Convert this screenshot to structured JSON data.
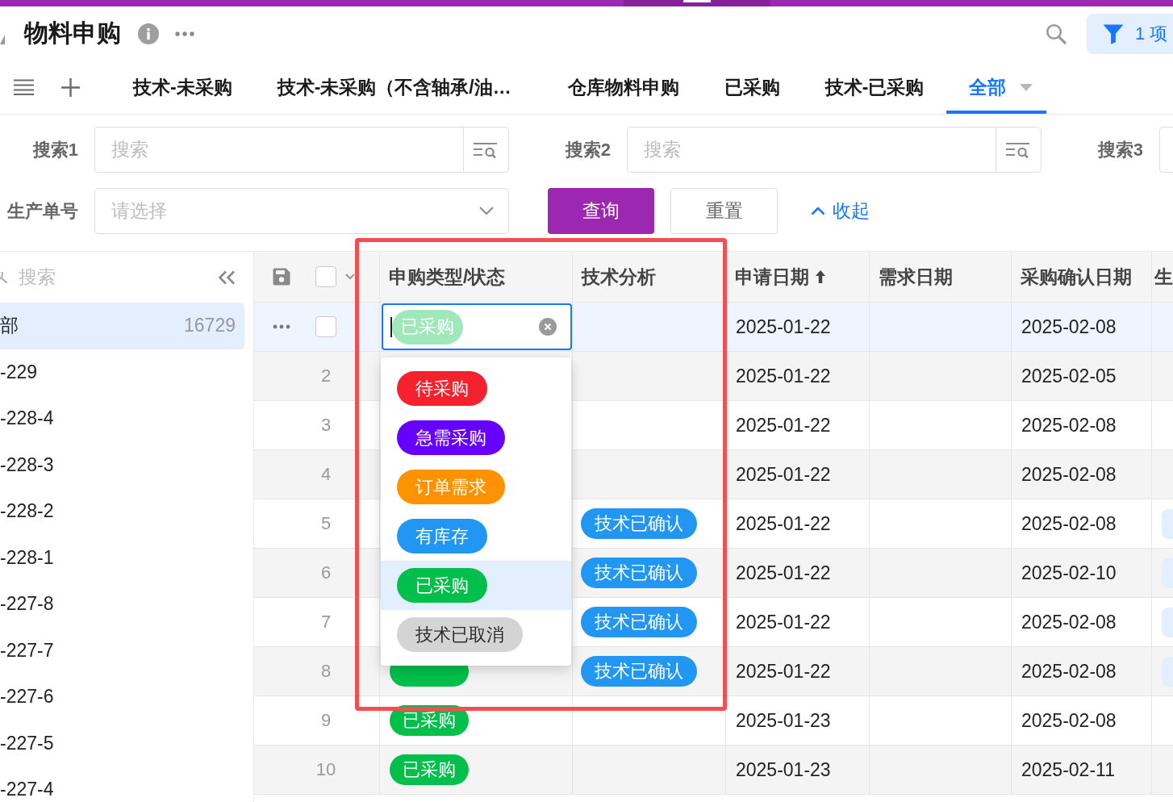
{
  "header": {
    "title": "物料申购",
    "filter_count": "1 项"
  },
  "view_tabs": [
    {
      "label": "技术-未采购",
      "selected": false
    },
    {
      "label": "技术-未采购（不含轴承/油…",
      "selected": false
    },
    {
      "label": "仓库物料申购",
      "selected": false
    },
    {
      "label": "已采购",
      "selected": false
    },
    {
      "label": "技术-已采购",
      "selected": false
    },
    {
      "label": "全部",
      "selected": true
    }
  ],
  "filters": {
    "search_fields": [
      {
        "label": "搜索1",
        "placeholder": "搜索"
      },
      {
        "label": "搜索2",
        "placeholder": "搜索"
      },
      {
        "label": "搜索3"
      }
    ],
    "production_number": {
      "label": "生产单号",
      "placeholder": "请选择"
    },
    "buttons": [
      {
        "label": "查询",
        "kind": "primary"
      },
      {
        "label": "重置",
        "kind": "default"
      }
    ],
    "collapse_link": "收起"
  },
  "sidebar": {
    "search": {
      "placeholder": "搜索"
    },
    "items": [
      {
        "label": "部",
        "count": "16729",
        "selected": true
      },
      {
        "label": "-229",
        "selected": false
      },
      {
        "label": "-228-4",
        "selected": false
      },
      {
        "label": "-228-3",
        "selected": false
      },
      {
        "label": "-228-2",
        "selected": false
      },
      {
        "label": "-228-1",
        "selected": false
      },
      {
        "label": "-227-8",
        "selected": false
      },
      {
        "label": "-227-7",
        "selected": false
      },
      {
        "label": "-227-6",
        "selected": false
      },
      {
        "label": "-227-5",
        "selected": false
      },
      {
        "label": "-227-4",
        "selected": false
      }
    ]
  },
  "table": {
    "select_all_checked": false,
    "columns": [
      {
        "label": "申购类型/状态"
      },
      {
        "label": "技术分析"
      },
      {
        "label": "申请日期",
        "sorted": true
      },
      {
        "label": "需求日期"
      },
      {
        "label": "采购确认日期"
      },
      {
        "label": "生"
      }
    ],
    "rows": [
      {
        "selected": true,
        "checked": false,
        "type_editor": {
          "value": {
            "label": "已采购",
            "color": "#a0e8bb"
          },
          "options": [
            {
              "label": "待采购",
              "color": "#f5222d",
              "selected": false
            },
            {
              "label": "急需采购",
              "color": "#6600ff",
              "selected": false
            },
            {
              "label": "订单需求",
              "color": "#ff9200",
              "selected": false
            },
            {
              "label": "有库存",
              "color": "#2196f3",
              "selected": false
            },
            {
              "label": "已采购",
              "color": "#00c04b",
              "selected": true
            },
            {
              "label": "技术已取消",
              "color": "#d4d4d4",
              "selected": false
            }
          ]
        },
        "apply_date": "2025-01-22",
        "confirm_date": "2025-02-08",
        "column_7_tag": false
      },
      {
        "number": "2",
        "selected": false,
        "apply_date": "2025-01-22",
        "confirm_date": "2025-02-05",
        "column_7_tag": false
      },
      {
        "number": "3",
        "selected": false,
        "apply_date": "2025-01-22",
        "confirm_date": "2025-02-08",
        "column_7_tag": false
      },
      {
        "number": "4",
        "selected": false,
        "apply_date": "2025-01-22",
        "confirm_date": "2025-02-08",
        "column_7_tag": false
      },
      {
        "number": "5",
        "selected": false,
        "analysis_tag": {
          "label": "技术已确认",
          "color": "#2196f3"
        },
        "apply_date": "2025-01-22",
        "confirm_date": "2025-02-08",
        "column_7_tag": true
      },
      {
        "number": "6",
        "selected": false,
        "analysis_tag": {
          "label": "技术已确认",
          "color": "#2196f3"
        },
        "apply_date": "2025-01-22",
        "confirm_date": "2025-02-10",
        "column_7_tag": true
      },
      {
        "number": "7",
        "selected": false,
        "analysis_tag": {
          "label": "技术已确认",
          "color": "#2196f3"
        },
        "apply_date": "2025-01-22",
        "confirm_date": "2025-02-08",
        "column_7_tag": true
      },
      {
        "number": "8",
        "selected": false,
        "type_tag": {
          "color": "#00c04b"
        },
        "analysis_tag": {
          "label": "技术已确认",
          "color": "#2196f3"
        },
        "apply_date": "2025-01-22",
        "confirm_date": "2025-02-08",
        "column_7_tag": true
      },
      {
        "number": "9",
        "selected": false,
        "type_tag": {
          "label": "已采购",
          "color": "#00c04b"
        },
        "apply_date": "2025-01-23",
        "confirm_date": "2025-02-08",
        "column_7_tag": false
      },
      {
        "number": "10",
        "selected": false,
        "type_tag": {
          "label": "已采购",
          "color": "#00c04b"
        },
        "apply_date": "2025-01-23",
        "confirm_date": "2025-02-11",
        "column_7_tag": false
      }
    ]
  }
}
